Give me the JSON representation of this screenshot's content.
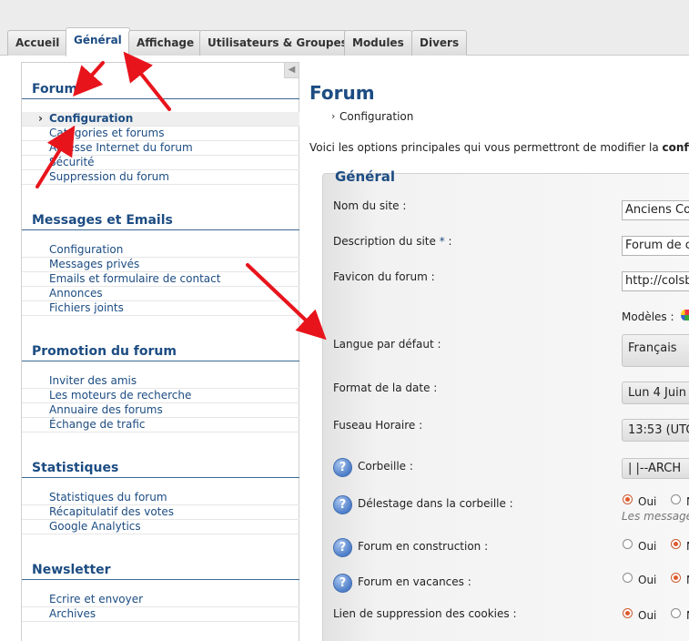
{
  "tabs": [
    "Accueil",
    "Général",
    "Affichage",
    "Utilisateurs & Groupes",
    "Modules",
    "Divers"
  ],
  "active_tab": "Général",
  "sidebar": {
    "collapse_glyph": "◀",
    "sections": [
      {
        "title": "Forum",
        "items": [
          "Configuration",
          "Catégories et forums",
          "Adresse Internet du forum",
          "Sécurité",
          "Suppression du forum"
        ]
      },
      {
        "title": "Messages et Emails",
        "items": [
          "Configuration",
          "Messages privés",
          "Emails et formulaire de contact",
          "Annonces",
          "Fichiers joints"
        ]
      },
      {
        "title": "Promotion du forum",
        "items": [
          "Inviter des amis",
          "Les moteurs de recherche",
          "Annuaire des forums",
          "Échange de trafic"
        ]
      },
      {
        "title": "Statistiques",
        "items": [
          "Statistiques du forum",
          "Récapitulatif des votes",
          "Google Analytics"
        ]
      },
      {
        "title": "Newsletter",
        "items": [
          "Ecrire et envoyer",
          "Archives"
        ]
      }
    ],
    "active_item": "Configuration"
  },
  "main": {
    "title": "Forum",
    "breadcrumb": "Configuration",
    "intro_prefix": "Voici les options principales qui vous permettront de modifier la ",
    "intro_bold": "configu",
    "panel_title": "Général",
    "fields": {
      "site_name": {
        "label": "Nom du site :",
        "value": "Anciens Co"
      },
      "site_description": {
        "label": "Description du site ",
        "star": "*",
        "label_suffix": " :",
        "value": "Forum de c"
      },
      "favicon": {
        "label": "Favicon du forum :",
        "value": "http://colsb"
      },
      "modeles_label": "Modèles :",
      "language": {
        "label": "Langue par défaut :",
        "value": "Français"
      },
      "date_format": {
        "label": "Format de la date :",
        "value": "Lun 4 Juin"
      },
      "timezone": {
        "label": "Fuseau Horaire :",
        "value": "13:53 (UTC"
      },
      "trash": {
        "label": "Corbeille :",
        "value": "|   |--ARCH"
      },
      "offload_trash": {
        "label": "Délestage dans la corbeille :",
        "yes": "Oui",
        "no": "N",
        "selected": "yes",
        "hint": "Les message"
      },
      "under_construction": {
        "label": "Forum en construction :",
        "yes": "Oui",
        "no": "N",
        "selected": "no"
      },
      "on_vacation": {
        "label": "Forum en vacances :",
        "yes": "Oui",
        "no": "N",
        "selected": "no"
      },
      "cookie_delete_link": {
        "label": "Lien de suppression des cookies :",
        "yes": "Oui",
        "no": "N",
        "selected": "yes"
      }
    }
  },
  "help_glyph": "?",
  "breadcrumb_glyph": "›",
  "active_bullet_glyph": "›",
  "annotation_color": "#e8141c"
}
